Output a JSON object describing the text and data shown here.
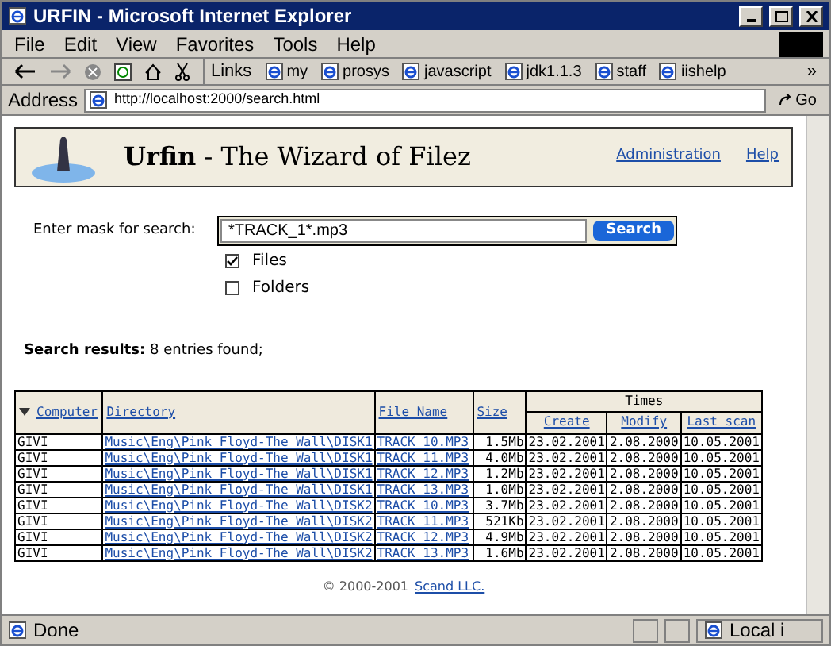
{
  "window": {
    "title": "URFIN - Microsoft Internet Explorer"
  },
  "menu": [
    "File",
    "Edit",
    "View",
    "Favorites",
    "Tools",
    "Help"
  ],
  "links_bar": {
    "label": "Links",
    "items": [
      "my",
      "prosys",
      "javascript",
      "jdk1.1.3",
      "staff",
      "iishelp"
    ],
    "more": "»"
  },
  "address_bar": {
    "label": "Address",
    "url": "http://localhost:2000/search.html",
    "go": "Go"
  },
  "page_header": {
    "title": "**Urfin** - The Wizard of Filez",
    "links": [
      "Administration",
      "Help"
    ]
  },
  "search": {
    "label": "Enter mask for search:",
    "value": "*TRACK_1*.mp3",
    "button": "Search",
    "options": [
      {
        "label": "Files",
        "checked": true
      },
      {
        "label": "Folders",
        "checked": false
      }
    ]
  },
  "results_summary": "**Search results:** 8 entries found;",
  "table": {
    "group_header": "Times",
    "columns": [
      {
        "label": "Computer",
        "sorted": true
      },
      {
        "label": "Directory",
        "sorted": false
      },
      {
        "label": "File Name",
        "sorted": false
      },
      {
        "label": "Size",
        "sorted": false
      },
      {
        "label": "Create",
        "sorted": false
      },
      {
        "label": "Modify",
        "sorted": false
      },
      {
        "label": "Last scan",
        "sorted": false
      }
    ],
    "rows": [
      [
        "GIVI",
        "Music\\Eng\\Pink Floyd-The Wall\\DISK1",
        "TRACK_10.MP3",
        "1.5Mb",
        "23.02.2001",
        "2.08.2000",
        "10.05.2001"
      ],
      [
        "GIVI",
        "Music\\Eng\\Pink Floyd-The Wall\\DISK1",
        "TRACK_11.MP3",
        "4.0Mb",
        "23.02.2001",
        "2.08.2000",
        "10.05.2001"
      ],
      [
        "GIVI",
        "Music\\Eng\\Pink Floyd-The Wall\\DISK1",
        "TRACK_12.MP3",
        "1.2Mb",
        "23.02.2001",
        "2.08.2000",
        "10.05.2001"
      ],
      [
        "GIVI",
        "Music\\Eng\\Pink Floyd-The Wall\\DISK1",
        "TRACK_13.MP3",
        "1.0Mb",
        "23.02.2001",
        "2.08.2000",
        "10.05.2001"
      ],
      [
        "GIVI",
        "Music\\Eng\\Pink Floyd-The Wall\\DISK2",
        "TRACK_10.MP3",
        "3.7Mb",
        "23.02.2001",
        "2.08.2000",
        "10.05.2001"
      ],
      [
        "GIVI",
        "Music\\Eng\\Pink Floyd-The Wall\\DISK2",
        "TRACK_11.MP3",
        "521Kb",
        "23.02.2001",
        "2.08.2000",
        "10.05.2001"
      ],
      [
        "GIVI",
        "Music\\Eng\\Pink Floyd-The Wall\\DISK2",
        "TRACK_12.MP3",
        "4.9Mb",
        "23.02.2001",
        "2.08.2000",
        "10.05.2001"
      ],
      [
        "GIVI",
        "Music\\Eng\\Pink Floyd-The Wall\\DISK2",
        "TRACK_13.MP3",
        "1.6Mb",
        "23.02.2001",
        "2.08.2000",
        "10.05.2001"
      ]
    ]
  },
  "footer": {
    "text": "© 2000-2001",
    "link": "Scand LLC."
  },
  "status_bar": {
    "text": "Done",
    "zone": "Local i"
  }
}
